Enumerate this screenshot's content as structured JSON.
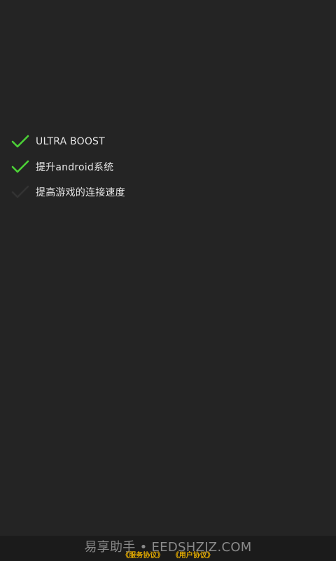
{
  "checklist": {
    "items": [
      {
        "label": "ULTRA BOOST",
        "checked": true
      },
      {
        "label": "提升android系统",
        "checked": true
      },
      {
        "label": "提高游戏的连接速度",
        "checked": false
      }
    ]
  },
  "footer": {
    "watermark": "易享助手 • EEDSHZJZ.COM",
    "service_agreement": "《服务协议》",
    "user_agreement": "《用户协议》"
  },
  "colors": {
    "background": "#242424",
    "check_active": "#4cd137",
    "check_inactive": "#333333",
    "link": "#e0a800"
  }
}
